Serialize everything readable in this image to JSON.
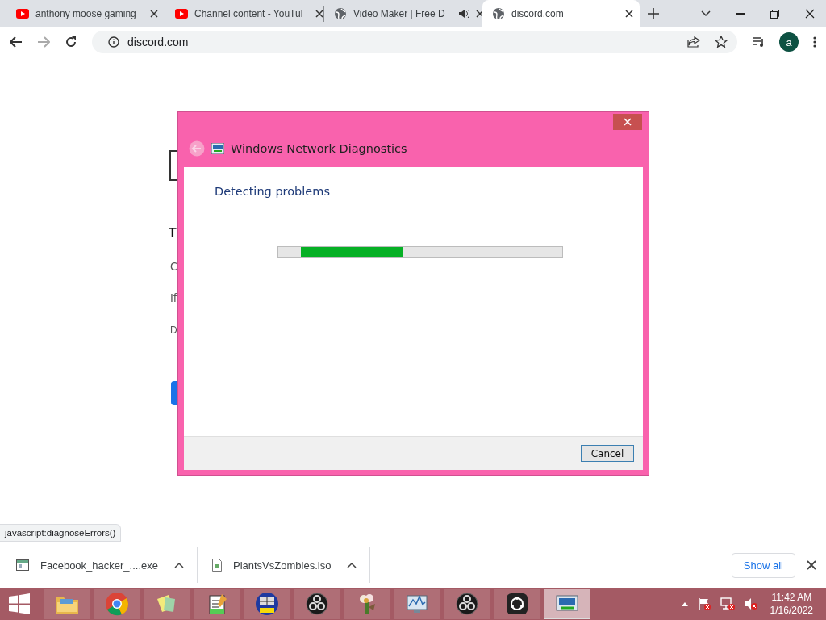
{
  "browser": {
    "tabs": [
      {
        "title": "anthony moose gaming",
        "kind": "video",
        "audio": false,
        "selected": false
      },
      {
        "title": "Channel content - YouTul",
        "kind": "video",
        "audio": false,
        "selected": false
      },
      {
        "title": "Video Maker | Free D",
        "kind": "web",
        "audio": true,
        "selected": false
      },
      {
        "title": "discord.com",
        "kind": "web",
        "audio": false,
        "selected": true
      }
    ],
    "address": "discord.com",
    "profile": "a"
  },
  "page_behind": {
    "fragments": [
      "T",
      "C",
      "If",
      "D"
    ]
  },
  "dialog": {
    "title": "Windows Network Diagnostics",
    "heading": "Detecting problems",
    "progress": {
      "kind": "marquee"
    },
    "buttons": [
      "Cancel"
    ]
  },
  "status_url": "javascript:diagnoseErrors()",
  "downloads": {
    "items": [
      {
        "name": "Facebook_hacker_....exe",
        "kind": "app"
      },
      {
        "name": "PlantsVsZombies.iso",
        "kind": "file"
      }
    ],
    "show_all": "Show all"
  },
  "taskbar": {
    "apps": [
      {
        "kind": "folder",
        "selected": false
      },
      {
        "kind": "chrome",
        "selected": false
      },
      {
        "kind": "notes",
        "selected": false
      },
      {
        "kind": "notepad",
        "selected": false
      },
      {
        "kind": "game",
        "selected": false
      },
      {
        "kind": "obs",
        "selected": false
      },
      {
        "kind": "plant",
        "selected": false
      },
      {
        "kind": "monitor",
        "selected": false
      },
      {
        "kind": "obs",
        "selected": false
      },
      {
        "kind": "camera",
        "selected": false
      },
      {
        "kind": "network",
        "selected": true
      }
    ],
    "time": "11:42 AM",
    "date": "1/16/2022"
  }
}
